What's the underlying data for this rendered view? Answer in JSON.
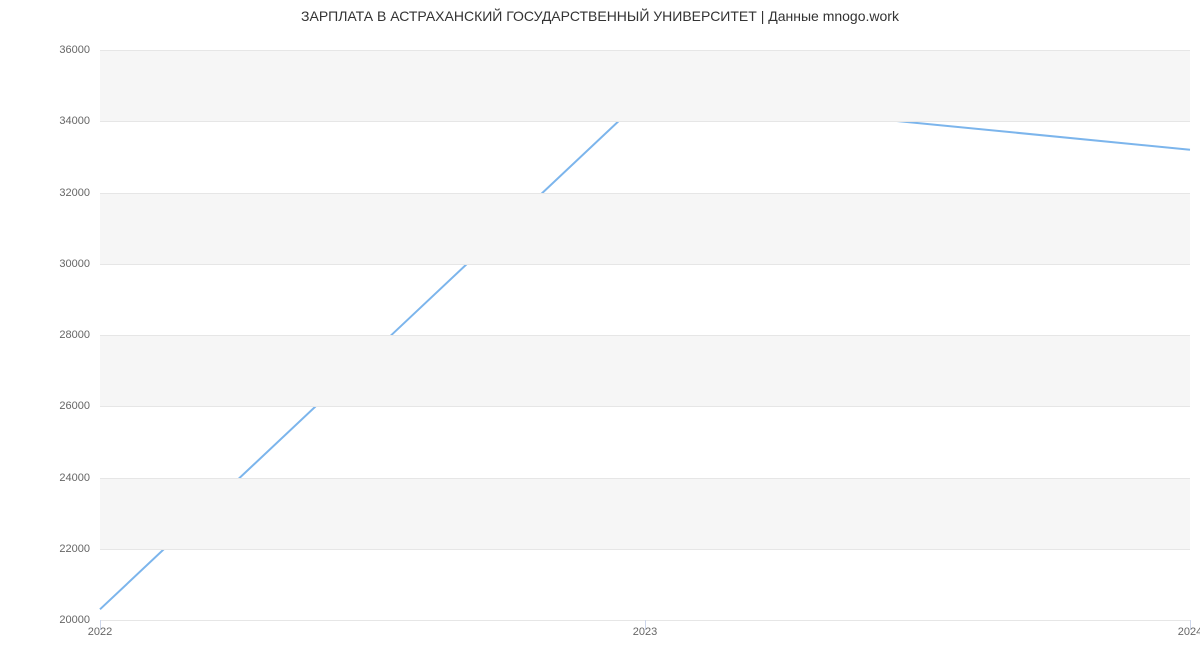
{
  "chart_data": {
    "type": "line",
    "title": "ЗАРПЛАТА В АСТРАХАНСКИЙ ГОСУДАРСТВЕННЫЙ УНИВЕРСИТЕТ | Данные mnogo.work",
    "xlabel": "",
    "ylabel": "",
    "x": [
      2022,
      2023,
      2024
    ],
    "values": [
      20300,
      34700,
      33200
    ],
    "x_ticks": [
      2022,
      2023,
      2024
    ],
    "y_ticks": [
      20000,
      22000,
      24000,
      26000,
      28000,
      30000,
      32000,
      34000,
      36000
    ],
    "xlim": [
      2022,
      2024
    ],
    "ylim": [
      20000,
      36000
    ],
    "line_color": "#7cb5ec"
  }
}
